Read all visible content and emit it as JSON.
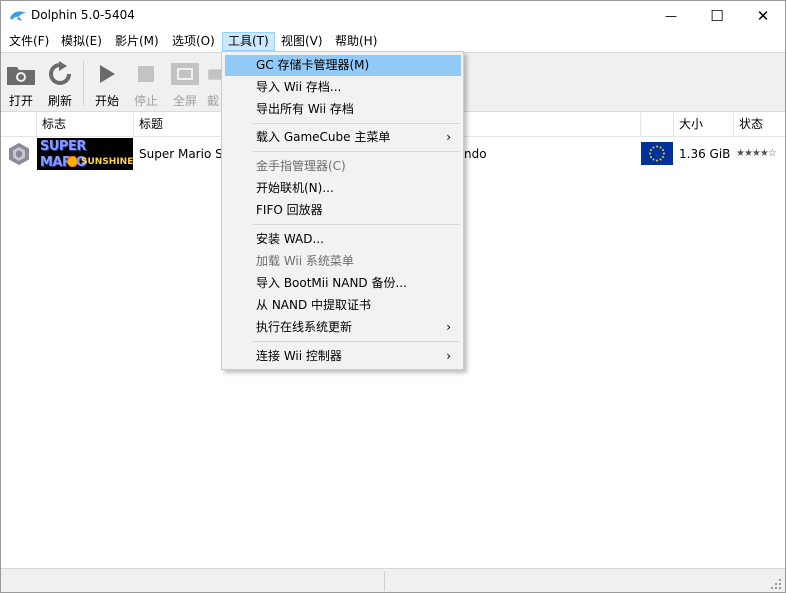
{
  "window": {
    "title": "Dolphin 5.0-5404",
    "minimize_glyph": "—",
    "maximize_glyph": "☐",
    "close_glyph": "✕"
  },
  "menubar": [
    {
      "label": "文件(F)"
    },
    {
      "label": "模拟(E)"
    },
    {
      "label": "影片(M)"
    },
    {
      "label": "选项(O)"
    },
    {
      "label": "工具(T)"
    },
    {
      "label": "视图(V)"
    },
    {
      "label": "帮助(H)"
    }
  ],
  "toolbar": {
    "open": "打开",
    "refresh": "刷新",
    "play": "开始",
    "stop": "停止",
    "fullscreen": "全屏",
    "screenshot": "截"
  },
  "list": {
    "headers": {
      "banner": "标志",
      "title": "标题",
      "size": "大小",
      "state": "状态"
    },
    "rows": [
      {
        "platform_icon": "gamecube-icon",
        "banner_line1": "SUPER MARIO",
        "banner_line2": "SUNSHINE",
        "title": "Super Mario S",
        "maker_tail": "ndo",
        "region": "europe-flag-icon",
        "size": "1.36 GiB",
        "rating": "★★★★☆"
      }
    ]
  },
  "tools_menu": {
    "items": [
      {
        "label": "GC 存储卡管理器(M)",
        "highlighted": true
      },
      {
        "label": "导入 Wii 存档..."
      },
      {
        "label": "导出所有 Wii 存档"
      },
      {
        "label": "载入 GameCube 主菜单",
        "submenu": "›"
      },
      {
        "label": "金手指管理器(C)",
        "disabled": true
      },
      {
        "label": "开始联机(N)..."
      },
      {
        "label": "FIFO 回放器"
      },
      {
        "label": "安装 WAD..."
      },
      {
        "label": "加载 Wii 系统菜单",
        "disabled": true
      },
      {
        "label": "导入 BootMii NAND 备份..."
      },
      {
        "label": "从 NAND 中提取证书"
      },
      {
        "label": "执行在线系统更新",
        "submenu": "›"
      },
      {
        "label": "连接 Wii 控制器",
        "submenu": "›"
      }
    ]
  },
  "colors": {
    "menu_highlight": "#91c9f7",
    "active_menu": "#cce8ff",
    "eu_blue": "#003399",
    "eu_star": "#ffcc00"
  }
}
